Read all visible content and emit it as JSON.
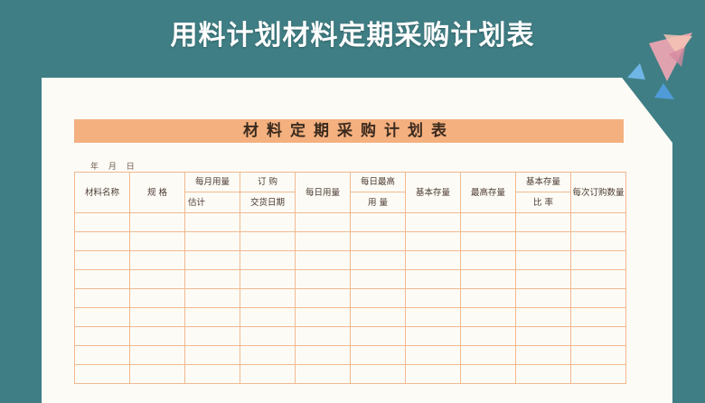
{
  "page": {
    "title": "用料计划材料定期采购计划表"
  },
  "sheet": {
    "title": "材料定期采购计划表",
    "date_label": "年 月 日",
    "columns": {
      "material_name": "材料名称",
      "spec": "规 格",
      "monthly_usage": "每月用量",
      "estimate": "估计",
      "order": "订 购",
      "delivery_date": "交货日期",
      "daily_usage": "每日用量",
      "daily_max_usage_top": "每日最高",
      "daily_max_usage_bottom": "用 量",
      "base_stock": "基本存量",
      "max_stock": "最高存量",
      "base_stock_ratio_top": "基本存量",
      "base_stock_ratio_bottom": "比 率",
      "order_qty_per_time": "每次订购数量"
    },
    "empty_rows": 9
  },
  "colors": {
    "background": "#3f7e84",
    "title_bar": "#f4b07f",
    "grid_line": "#f0b990"
  }
}
